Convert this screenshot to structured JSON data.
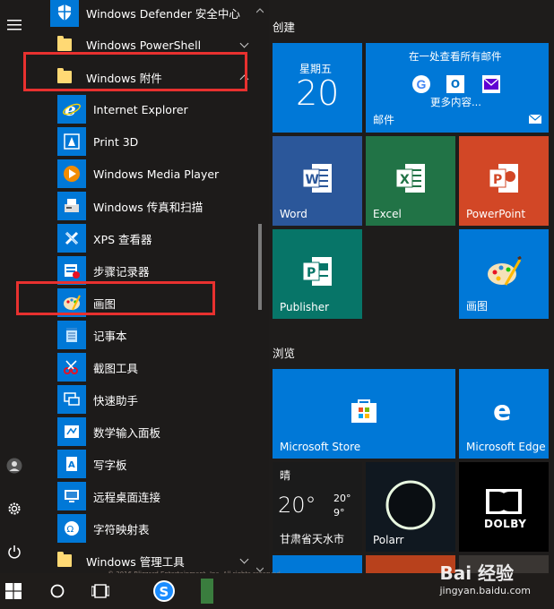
{
  "rail": {
    "icons": [
      "hamburger-menu-icon",
      "user-icon",
      "gear-icon",
      "power-icon"
    ]
  },
  "applist": {
    "defender": "Windows Defender 安全中心",
    "powershell": "Windows PowerShell",
    "accessories": "Windows 附件",
    "ie": "Internet Explorer",
    "print3d": "Print 3D",
    "wmp": "Windows Media Player",
    "fax": "Windows 传真和扫描",
    "xps": "XPS 查看器",
    "steps": "步骤记录器",
    "paint": "画图",
    "notepad": "记事本",
    "snipping": "截图工具",
    "quickassist": "快速助手",
    "math": "数学输入面板",
    "wordpad": "写字板",
    "rdp": "远程桌面连接",
    "charmap": "字符映射表",
    "admin": "Windows 管理工具"
  },
  "tiles": {
    "group_create": "创建",
    "group_browse": "浏览",
    "calendar_day": "星期五",
    "calendar_date": "20",
    "mail_text": "在一处查看所有邮件",
    "mail_more": "更多内容...",
    "mail_label": "邮件",
    "word": "Word",
    "excel": "Excel",
    "powerpoint": "PowerPoint",
    "publisher": "Publisher",
    "paint": "画图",
    "store": "Microsoft Store",
    "edge": "Microsoft Edge",
    "weather_cond": "晴",
    "weather_temp": "20°",
    "weather_high": "20°",
    "weather_low": "9°",
    "weather_city": "甘肃省天水市",
    "polarr": "Polarr",
    "dolby": "DOLBY"
  },
  "background_text": "© 2016 Blizzard Entertainment, Inc. All rights reserved.",
  "watermark": {
    "brand": "Bai 经验",
    "url": "jingyan.baidu.com"
  },
  "colors": {
    "tile_blue": "#0078d7",
    "highlight_red": "#e8312f",
    "folder_yellow": "#ffd974"
  }
}
